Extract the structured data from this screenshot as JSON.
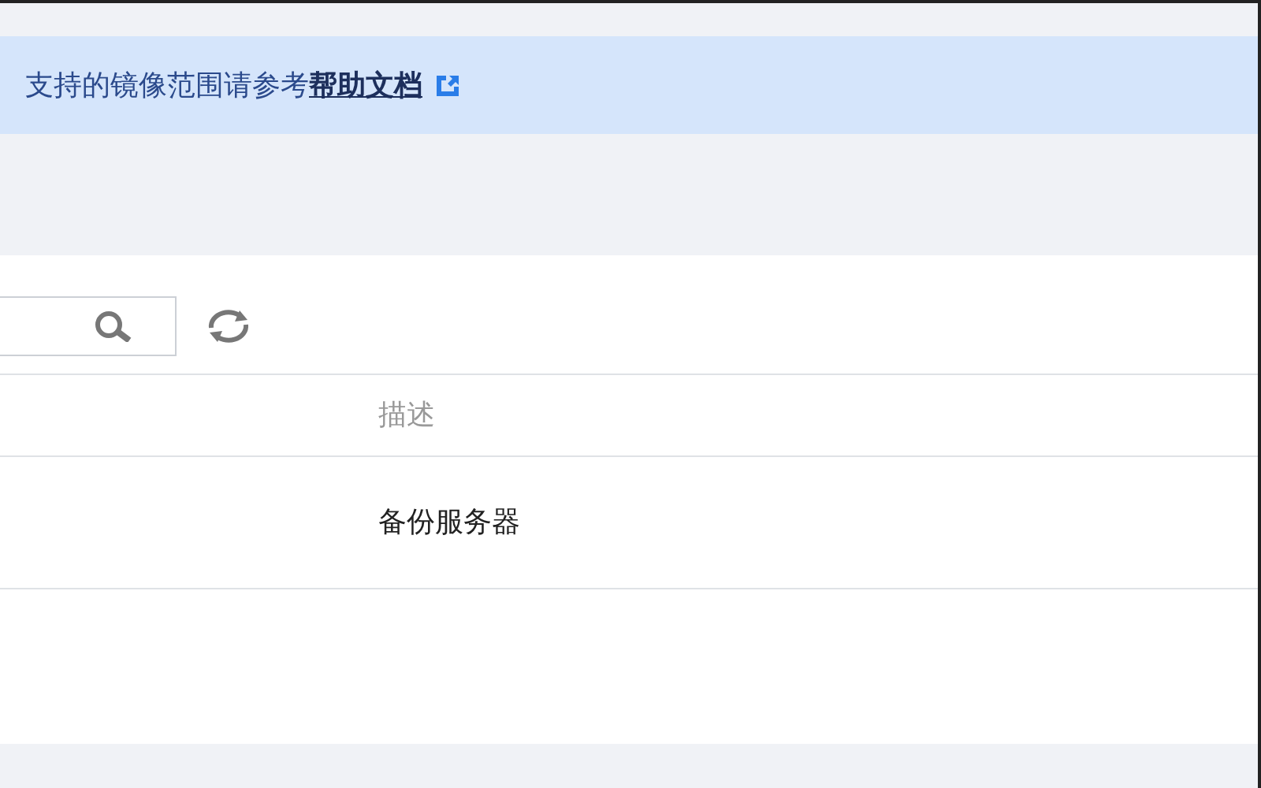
{
  "notice": {
    "text": "支持的镜像范围请参考",
    "link": "帮助文档"
  },
  "table": {
    "columns": [
      "描述"
    ],
    "rows": [
      {
        "cells": [
          "备份服务器"
        ]
      }
    ]
  }
}
